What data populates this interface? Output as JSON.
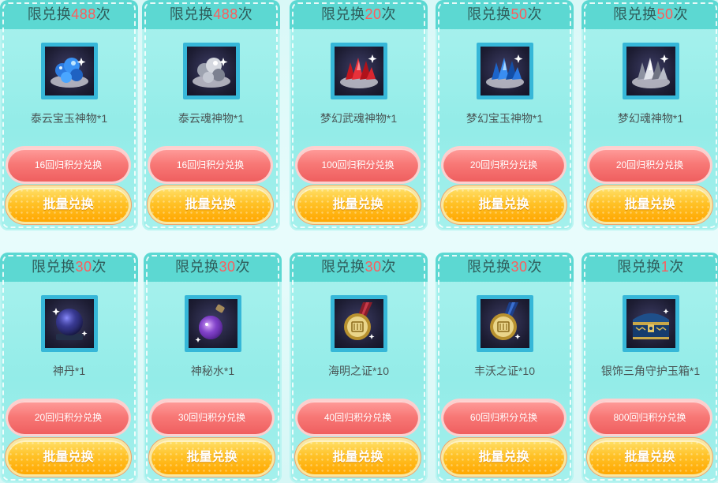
{
  "cards": [
    {
      "limit_prefix": "限兑换",
      "limit_count": "488",
      "limit_suffix": "次",
      "item_name": "泰云宝玉神物*1",
      "item_icon": "blue-gem-cluster-icon",
      "points_label": "16回归积分兑换",
      "bulk_label": "批量兑换"
    },
    {
      "limit_prefix": "限兑换",
      "limit_count": "488",
      "limit_suffix": "次",
      "item_name": "泰云魂神物*1",
      "item_icon": "silver-gem-cluster-icon",
      "points_label": "16回归积分兑换",
      "bulk_label": "批量兑换"
    },
    {
      "limit_prefix": "限兑换",
      "limit_count": "20",
      "limit_suffix": "次",
      "item_name": "梦幻武魂神物*1",
      "item_icon": "red-crystal-cluster-icon",
      "points_label": "100回归积分兑换",
      "bulk_label": "批量兑换"
    },
    {
      "limit_prefix": "限兑换",
      "limit_count": "50",
      "limit_suffix": "次",
      "item_name": "梦幻宝玉神物*1",
      "item_icon": "blue-crystal-cluster-icon",
      "points_label": "20回归积分兑换",
      "bulk_label": "批量兑换"
    },
    {
      "limit_prefix": "限兑换",
      "limit_count": "50",
      "limit_suffix": "次",
      "item_name": "梦幻魂神物*1",
      "item_icon": "silver-crystal-cluster-icon",
      "points_label": "20回归积分兑换",
      "bulk_label": "批量兑换"
    },
    {
      "limit_prefix": "限兑换",
      "limit_count": "30",
      "limit_suffix": "次",
      "item_name": "神丹*1",
      "item_icon": "dark-orb-icon",
      "points_label": "20回归积分兑换",
      "bulk_label": "批量兑换"
    },
    {
      "limit_prefix": "限兑换",
      "limit_count": "30",
      "limit_suffix": "次",
      "item_name": "神秘水*1",
      "item_icon": "potion-flask-icon",
      "points_label": "30回归积分兑换",
      "bulk_label": "批量兑换"
    },
    {
      "limit_prefix": "限兑换",
      "limit_count": "30",
      "limit_suffix": "次",
      "item_name": "海明之证*10",
      "item_icon": "red-medal-icon",
      "points_label": "40回归积分兑换",
      "bulk_label": "批量兑换"
    },
    {
      "limit_prefix": "限兑换",
      "limit_count": "30",
      "limit_suffix": "次",
      "item_name": "丰沃之证*10",
      "item_icon": "blue-medal-icon",
      "points_label": "60回归积分兑换",
      "bulk_label": "批量兑换"
    },
    {
      "limit_prefix": "限兑换",
      "limit_count": "1",
      "limit_suffix": "次",
      "item_name": "银饰三角守护玉箱*1",
      "item_icon": "treasure-chest-icon",
      "points_label": "800回归积分兑换",
      "bulk_label": "批量兑换"
    }
  ],
  "colors": {
    "header_bg": "#5cd8d2",
    "limit_count": "#ff5b5b",
    "points_button": "#f87977",
    "bulk_button": "#ffc227",
    "card_bg": "#a4f0ec"
  }
}
